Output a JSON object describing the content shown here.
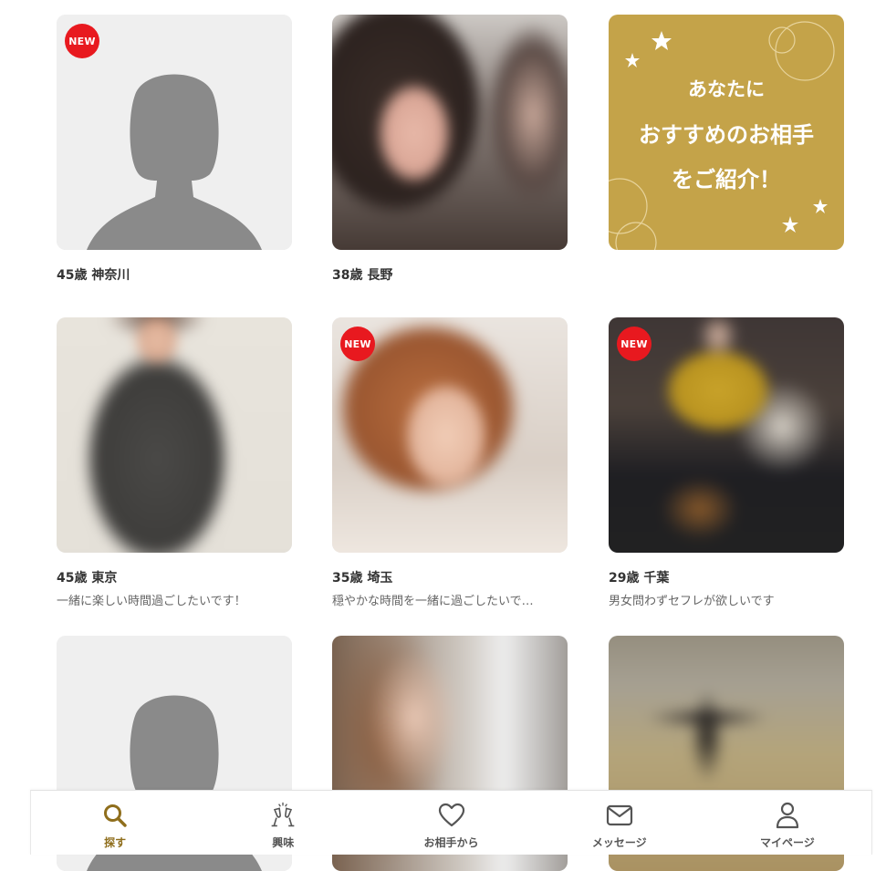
{
  "colors": {
    "accent": "#8f6e1c",
    "promo_bg": "#c4a349",
    "new_badge": "#e8191f"
  },
  "cards": [
    {
      "title": "45歳 神奈川",
      "message": "",
      "new": "NEW",
      "photo": "silhouette"
    },
    {
      "title": "38歳 長野",
      "message": "",
      "new": "",
      "photo": "blurred-photo"
    },
    {
      "title": "",
      "message": "",
      "new": "",
      "photo": "promo"
    },
    {
      "title": "45歳 東京",
      "message": "一緒に楽しい時間過ごしたいです！",
      "new": "",
      "photo": "blurred-photo"
    },
    {
      "title": "35歳 埼玉",
      "message": "穏やかな時間を一緒に過ごしたいで…",
      "new": "NEW",
      "photo": "blurred-photo"
    },
    {
      "title": "29歳 千葉",
      "message": "男女問わずセフレが欲しいです",
      "new": "NEW",
      "photo": "blurred-photo"
    },
    {
      "title": "",
      "message": "",
      "new": "",
      "photo": "silhouette"
    },
    {
      "title": "",
      "message": "",
      "new": "",
      "photo": "blurred-photo"
    },
    {
      "title": "",
      "message": "",
      "new": "",
      "photo": "blurred-photo"
    }
  ],
  "promo": {
    "line1": "あなたに",
    "line2": "おすすめのお相手",
    "line3": "をご紹介！"
  },
  "nav": [
    {
      "label": "探す",
      "icon": "search-icon",
      "active": true
    },
    {
      "label": "興味",
      "icon": "cheers-icon",
      "active": false
    },
    {
      "label": "お相手から",
      "icon": "heart-icon",
      "active": false
    },
    {
      "label": "メッセージ",
      "icon": "mail-icon",
      "active": false
    },
    {
      "label": "マイページ",
      "icon": "person-icon",
      "active": false
    }
  ]
}
